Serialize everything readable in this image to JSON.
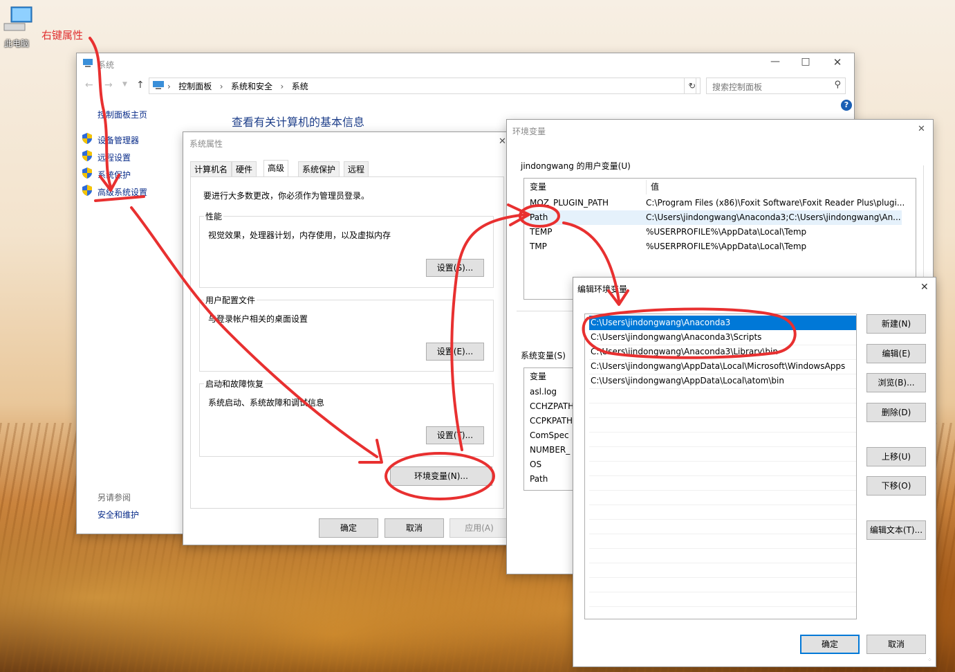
{
  "desktop": {
    "this_pc_label": "此电脑",
    "annotation": "右键属性"
  },
  "system_window": {
    "title": "系统",
    "breadcrumb": [
      "控制面板",
      "系统和安全",
      "系统"
    ],
    "search_placeholder": "搜索控制面板",
    "sidebar_home": "控制面板主页",
    "sidebar_items": [
      "设备管理器",
      "远程设置",
      "系统保护",
      "高级系统设置"
    ],
    "see_also": "另请参阅",
    "see_also_link": "安全和维护",
    "main_heading": "查看有关计算机的基本信息"
  },
  "sysprops": {
    "title": "系统属性",
    "tabs": [
      "计算机名",
      "硬件",
      "高级",
      "系统保护",
      "远程"
    ],
    "admin_note": "要进行大多数更改，你必须作为管理员登录。",
    "perf_title": "性能",
    "perf_desc": "视觉效果，处理器计划，内存使用，以及虚拟内存",
    "perf_btn": "设置(S)...",
    "profile_title": "用户配置文件",
    "profile_desc": "与登录帐户相关的桌面设置",
    "profile_btn": "设置(E)...",
    "startup_title": "启动和故障恢复",
    "startup_desc": "系统启动、系统故障和调试信息",
    "startup_btn": "设置(T)...",
    "env_btn": "环境变量(N)...",
    "ok": "确定",
    "cancel": "取消",
    "apply": "应用(A)"
  },
  "envvars": {
    "title": "环境变量",
    "user_group": "jindongwang 的用户变量(U)",
    "col_var": "变量",
    "col_val": "值",
    "user_vars": [
      {
        "name": "MOZ_PLUGIN_PATH",
        "value": "C:\\Program Files (x86)\\Foxit Software\\Foxit Reader Plus\\plugi..."
      },
      {
        "name": "Path",
        "value": "C:\\Users\\jindongwang\\Anaconda3;C:\\Users\\jindongwang\\An..."
      },
      {
        "name": "TEMP",
        "value": "%USERPROFILE%\\AppData\\Local\\Temp"
      },
      {
        "name": "TMP",
        "value": "%USERPROFILE%\\AppData\\Local\\Temp"
      }
    ],
    "sys_group": "系统变量(S)",
    "sys_vars": [
      "asl.log",
      "CCHZPATH",
      "CCPKPATH",
      "ComSpec",
      "NUMBER_",
      "OS",
      "Path"
    ]
  },
  "edit_env": {
    "title": "编辑环境变量",
    "entries": [
      "C:\\Users\\jindongwang\\Anaconda3",
      "C:\\Users\\jindongwang\\Anaconda3\\Scripts",
      "C:\\Users\\jindongwang\\Anaconda3\\Library\\bin",
      "C:\\Users\\jindongwang\\AppData\\Local\\Microsoft\\WindowsApps",
      "C:\\Users\\jindongwang\\AppData\\Local\\atom\\bin"
    ],
    "buttons": [
      "新建(N)",
      "编辑(E)",
      "浏览(B)...",
      "删除(D)",
      "上移(U)",
      "下移(O)",
      "编辑文本(T)..."
    ],
    "ok": "确定",
    "cancel": "取消"
  },
  "colors": {
    "accent": "#0078d7",
    "annotation_red": "#e83030",
    "link": "#0a2d8a"
  }
}
